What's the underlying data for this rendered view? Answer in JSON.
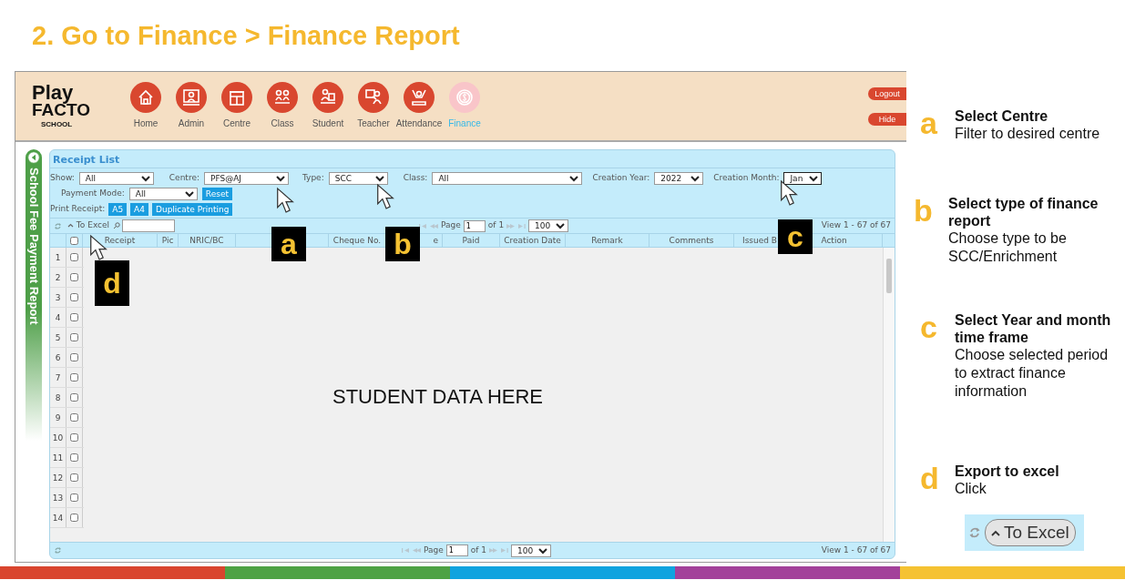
{
  "slide_title": "2. Go to Finance > Finance Report",
  "app": {
    "logo": {
      "line_1": "Play",
      "line_2": "FACTO",
      "line_3": "SCHOOL"
    },
    "nav": [
      {
        "label": "Home",
        "selected": false
      },
      {
        "label": "Admin",
        "selected": false
      },
      {
        "label": "Centre",
        "selected": false
      },
      {
        "label": "Class",
        "selected": false
      },
      {
        "label": "Student",
        "selected": false
      },
      {
        "label": "Teacher",
        "selected": false
      },
      {
        "label": "Attendance",
        "selected": false
      },
      {
        "label": "Finance",
        "selected": true
      }
    ],
    "header_buttons": [
      "Logout",
      "Hide"
    ],
    "side_tab": "School Fee Payment Report",
    "panel_title": "Receipt List",
    "filters": [
      {
        "label": "Show:",
        "value": "All"
      },
      {
        "label": "Centre:",
        "value": "PFS@AJ"
      },
      {
        "label": "Type:",
        "value": "SCC"
      },
      {
        "label": "Class:",
        "value": "All"
      },
      {
        "label": "Creation Year:",
        "value": "2022"
      },
      {
        "label": "Creation Month:",
        "value": "Jan"
      }
    ],
    "payment_mode": {
      "label": "Payment Mode:",
      "value": "All"
    },
    "reset_button": "Reset",
    "print_receipt": {
      "label": "Print Receipt:",
      "buttons": [
        "A5",
        "A4",
        "Duplicate Printing"
      ]
    },
    "export_button": "To Excel",
    "pagers": [
      {
        "page_label": "Page",
        "page": "1",
        "of": "of 1",
        "page_size": "100",
        "view": "View 1 - 67 of 67"
      },
      {
        "page_label": "Page",
        "page": "1",
        "of": "of 1",
        "page_size": "100",
        "view": "View 1 - 67 of 67"
      }
    ],
    "header_checkbox": {
      "checked": false
    },
    "columns": [
      {
        "label": "Receipt"
      },
      {
        "label": "Pic"
      },
      {
        "label": "NRIC/BC"
      },
      {},
      {
        "label": "Cheque No."
      },
      {
        "label": "e"
      },
      {
        "label": "Paid"
      },
      {
        "label": "Creation Date"
      },
      {
        "label": "Remark"
      },
      {
        "label": "Comments"
      },
      {
        "label": "Issued B"
      },
      {
        "label": "Action"
      }
    ],
    "rows": [
      {
        "number": "1",
        "checked": false
      },
      {
        "number": "2",
        "checked": false
      },
      {
        "number": "3",
        "checked": false
      },
      {
        "number": "4",
        "checked": false
      },
      {
        "number": "5",
        "checked": false
      },
      {
        "number": "6",
        "checked": false
      },
      {
        "number": "7",
        "checked": false
      },
      {
        "number": "8",
        "checked": false
      },
      {
        "number": "9",
        "checked": false
      },
      {
        "number": "10",
        "checked": false
      },
      {
        "number": "11",
        "checked": false
      },
      {
        "number": "12",
        "checked": false
      },
      {
        "number": "13",
        "checked": false
      },
      {
        "number": "14",
        "checked": false
      }
    ],
    "data_note": "STUDENT DATA HERE"
  },
  "callouts": [
    "a",
    "b",
    "c",
    "d"
  ],
  "steps": [
    {
      "letter": "a",
      "title": "Select Centre",
      "text": "Filter to desired centre"
    },
    {
      "letter": "b",
      "title": "Select type of finance report",
      "text": "Choose type to be SCC/Enrichment"
    },
    {
      "letter": "c",
      "title": "Select Year and month time frame",
      "text": "Choose selected period to extract finance information"
    },
    {
      "letter": "d",
      "title": "Export to excel",
      "text": "Click"
    }
  ],
  "excel_preview": {
    "label": "To Excel"
  },
  "color_bar": [
    {
      "color": "#d9452e"
    },
    {
      "color": "#4ea244"
    },
    {
      "color": "#0fa3df"
    },
    {
      "color": "#a3419a"
    },
    {
      "color": "#f5c232"
    }
  ]
}
